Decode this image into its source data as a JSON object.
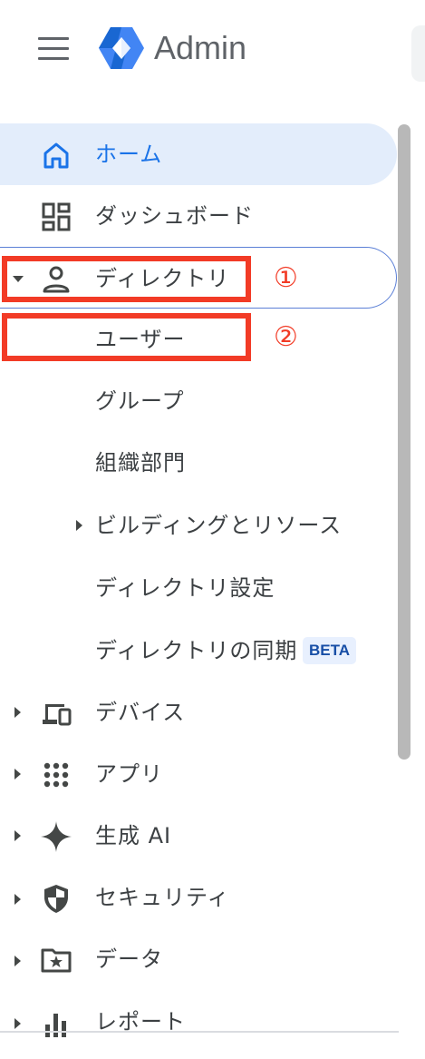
{
  "header": {
    "title": "Admin",
    "menu_icon": "hamburger-menu-icon",
    "logo_icon": "google-admin-hexagon-logo"
  },
  "colors": {
    "active_bg": "#e3edfb",
    "active_text": "#1a73e8",
    "highlight": "#f23b26",
    "beta_bg": "#e8f0fe",
    "beta_text": "#174ea6"
  },
  "nav": {
    "home": {
      "label": "ホーム",
      "icon": "home-icon"
    },
    "dashboard": {
      "label": "ダッシュボード",
      "icon": "dashboard-icon"
    },
    "directory": {
      "label": "ディレクトリ",
      "icon": "person-icon"
    },
    "users": {
      "label": "ユーザー"
    },
    "groups": {
      "label": "グループ"
    },
    "org_units": {
      "label": "組織部門"
    },
    "buildings": {
      "label": "ビルディングとリソース"
    },
    "dir_settings": {
      "label": "ディレクトリ設定"
    },
    "dir_sync": {
      "label": "ディレクトリの同期",
      "badge": "BETA"
    },
    "devices": {
      "label": "デバイス",
      "icon": "devices-icon"
    },
    "apps": {
      "label": "アプリ",
      "icon": "apps-grid-icon"
    },
    "gen_ai": {
      "label": "生成 AI",
      "icon": "sparkle-icon"
    },
    "security": {
      "label": "セキュリティ",
      "icon": "shield-icon"
    },
    "data": {
      "label": "データ",
      "icon": "folder-star-icon"
    },
    "reports": {
      "label": "レポート",
      "icon": "bar-chart-icon"
    }
  },
  "annotations": {
    "one": "①",
    "two": "②"
  }
}
